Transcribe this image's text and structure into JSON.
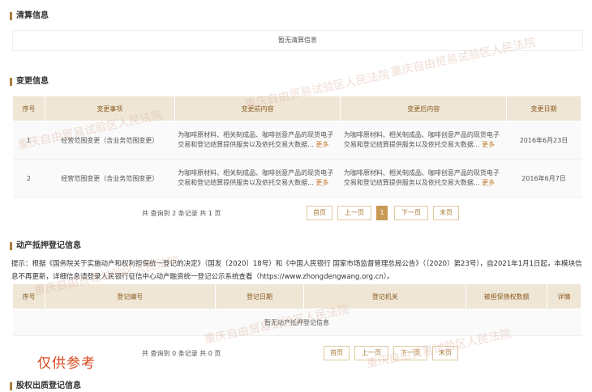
{
  "clearing": {
    "title": "清算信息",
    "empty": "暂无清算信息"
  },
  "changes": {
    "title": "变更信息",
    "headers": [
      "序号",
      "变更事项",
      "变更前内容",
      "变更后内容",
      "变更日期"
    ],
    "rows": [
      {
        "no": "1",
        "item": "经营范围变更（含业务范围变更）",
        "before": "为咖啡原材料、相关制成品、咖啡创意产品的现货电子交易和登记结算提供服务以及依托交易大数据...",
        "after": "为咖啡原材料、相关制成品、咖啡创意产品的现货电子交易和登记结算提供服务以及依托交易大数据...",
        "date": "2016年6月23日"
      },
      {
        "no": "2",
        "item": "经营范围变更（含业务范围变更）",
        "before": "为咖啡原材料、相关制成品、咖啡创意产品的现货电子交易和登记结算提供服务以及依托交易大数据...",
        "after": "为咖啡原材料、相关制成品、咖啡创意产品的现货电子交易和登记结算提供服务以及依托交易大数据...",
        "date": "2016年6月7日"
      }
    ],
    "more_label": "更多",
    "pager": {
      "count": "共 查询到 2 条记录 共 1 页",
      "first": "首页",
      "prev": "上一页",
      "current": "1",
      "next": "下一页",
      "last": "末页"
    }
  },
  "mortgage": {
    "title": "动产抵押登记信息",
    "notice": "提示：根据《国务院关于实施动产和权利担保统一登记的决定》（国发〔2020〕18号）和《中国人民银行 国家市场监督管理总局公告》（〔2020〕第23号），自2021年1月1日起，本模块信息不再更新，详细信息请登录人民银行征信中心动产融资统一登记公示系统查看（https://www.zhongdengwang.org.cn）。",
    "headers": [
      "序号",
      "登记编号",
      "登记日期",
      "登记机关",
      "被担保债权数额",
      "详情"
    ],
    "empty": "暂无动产抵押登记信息",
    "pager": {
      "count": "共 查询到 0 条记录 共 0 页",
      "first": "首页",
      "prev": "上一页",
      "next": "下一页",
      "last": "末页"
    }
  },
  "equity": {
    "title": "股权出质登记信息"
  },
  "stamp": "仅供参考",
  "watermark": "重庆自由贸易试验区人民法院"
}
